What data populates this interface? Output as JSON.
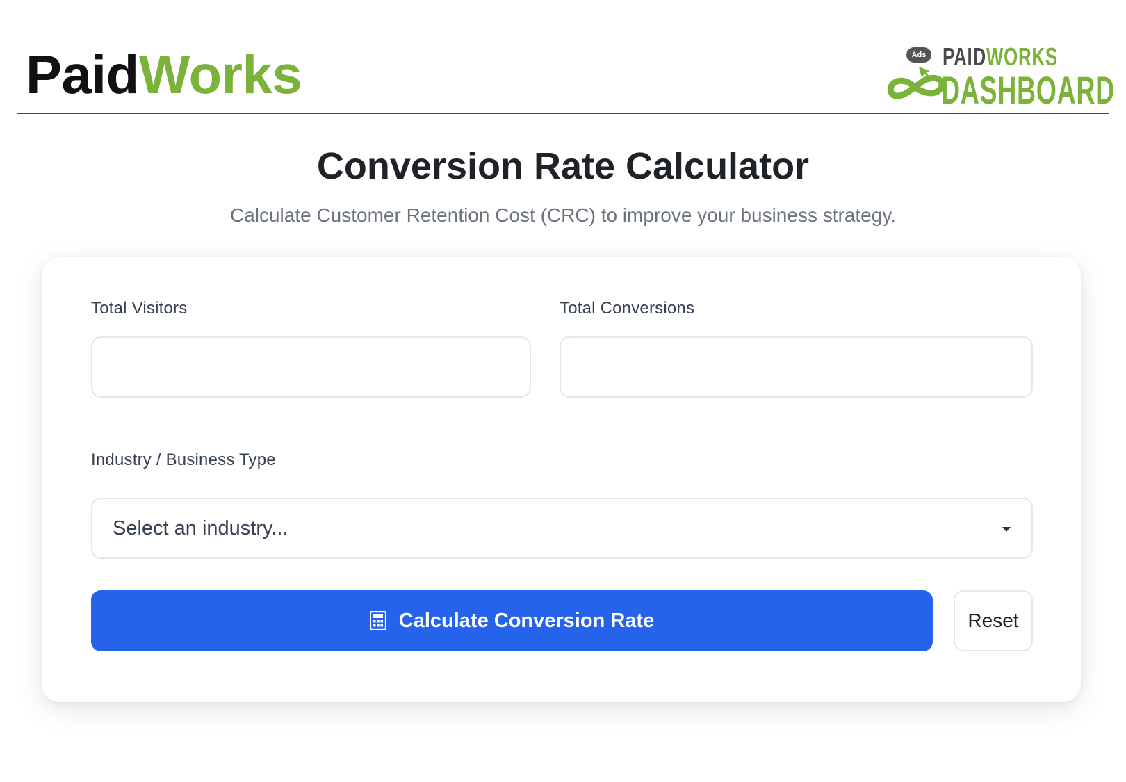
{
  "header": {
    "brand_part1": "Paid",
    "brand_part2": "Works",
    "logo_top_part1": "PAID",
    "logo_top_part2": "WORKS",
    "logo_bottom": "DASHBOARD",
    "logo_badge": "Ads",
    "colors": {
      "green": "#7bb23a",
      "dark": "#111111"
    }
  },
  "page": {
    "title": "Conversion Rate Calculator",
    "subtitle": "Calculate Customer Retention Cost (CRC) to improve your business strategy."
  },
  "form": {
    "visitors_label": "Total Visitors",
    "visitors_value": "",
    "conversions_label": "Total Conversions",
    "conversions_value": "",
    "industry_label": "Industry / Business Type",
    "industry_selected": "Select an industry...",
    "calculate_label": "Calculate Conversion Rate",
    "calculate_icon": "calculator-icon",
    "reset_label": "Reset"
  },
  "theme": {
    "primary": "#2563eb",
    "border": "#e5e7eb",
    "muted_text": "#6b7280"
  }
}
